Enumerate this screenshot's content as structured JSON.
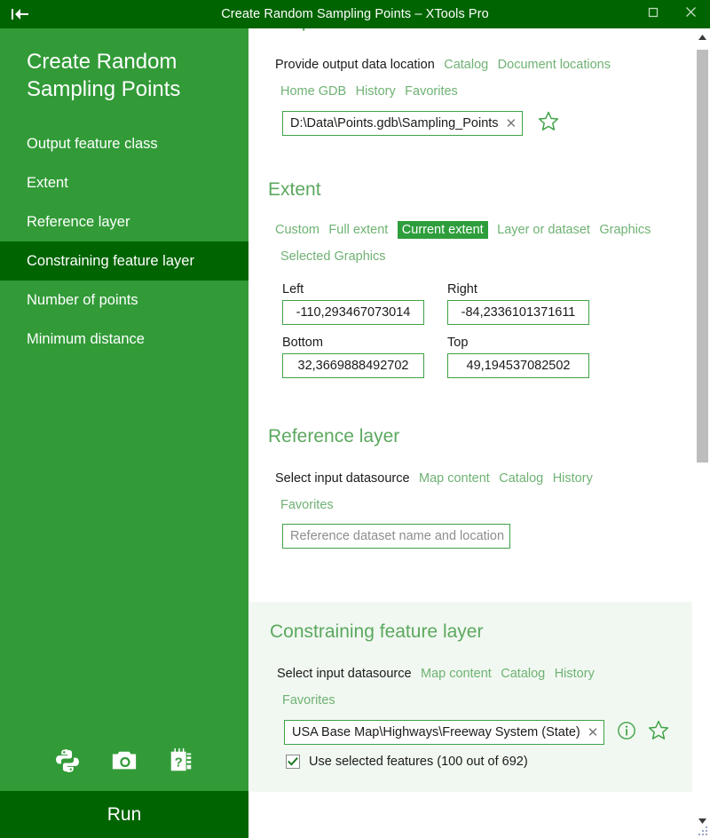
{
  "window": {
    "title": "Create Random Sampling Points – XTools Pro",
    "back_icon": "back-to-start-icon",
    "maximize_icon": "maximize-icon",
    "close_icon": "close-icon"
  },
  "sidebar": {
    "title": "Create Random\nSampling Points",
    "items": [
      {
        "label": "Output feature class",
        "selected": false
      },
      {
        "label": "Extent",
        "selected": false
      },
      {
        "label": "Reference layer",
        "selected": false
      },
      {
        "label": "Constraining feature layer",
        "selected": true
      },
      {
        "label": "Number of points",
        "selected": false
      },
      {
        "label": "Minimum distance",
        "selected": false
      }
    ],
    "tool_icons": [
      {
        "name": "python-icon"
      },
      {
        "name": "camera-icon"
      },
      {
        "name": "help-notebook-icon"
      }
    ],
    "run_label": "Run"
  },
  "content": {
    "cut_heading": "Output feature class",
    "output": {
      "prompt": "Provide output data location",
      "sources": [
        "Catalog",
        "Document locations"
      ],
      "sources2": [
        "Home GDB",
        "History",
        "Favorites"
      ],
      "path_value": "D:\\Data\\Points.gdb\\Sampling_Points",
      "clear_glyph": "✕",
      "favorite_icon": "star-icon"
    },
    "extent": {
      "heading": "Extent",
      "tabs": [
        "Custom",
        "Full extent",
        "Current extent",
        "Layer or dataset",
        "Graphics"
      ],
      "tabs2": [
        "Selected Graphics"
      ],
      "active_tab": "Current extent",
      "fields": [
        {
          "label": "Left",
          "value": "-110,293467073014"
        },
        {
          "label": "Right",
          "value": "-84,2336101371611"
        },
        {
          "label": "Bottom",
          "value": "32,3669888492702"
        },
        {
          "label": "Top",
          "value": "49,194537082502"
        }
      ]
    },
    "reference_layer": {
      "heading": "Reference layer",
      "prompt": "Select input datasource",
      "sources": [
        "Map content",
        "Catalog",
        "History"
      ],
      "sources2": [
        "Favorites"
      ],
      "placeholder": "Reference dataset name and location"
    },
    "constraining_layer": {
      "heading": "Constraining feature layer",
      "prompt": "Select input datasource",
      "sources": [
        "Map content",
        "Catalog",
        "History"
      ],
      "sources2": [
        "Favorites"
      ],
      "value": "USA Base Map\\Highways\\Freeway System (State)",
      "clear_glyph": "✕",
      "info_icon": "info-icon",
      "favorite_icon": "star-icon",
      "checkbox": {
        "checked": true,
        "label": "Use selected features (100 out of 692)"
      }
    }
  },
  "scrollbar": {
    "up_icon": "scroll-up-icon",
    "down_icon": "scroll-down-icon"
  },
  "colors": {
    "titlebar": "#006400",
    "sidebar": "#329B38",
    "sidebar_selected": "#006400",
    "accent_green": "#3FA246",
    "link_green": "#6FB273",
    "heading_green": "#5CA85F",
    "active_tab": "#2E9E3C",
    "panel_highlight": "#F1F8F1"
  }
}
